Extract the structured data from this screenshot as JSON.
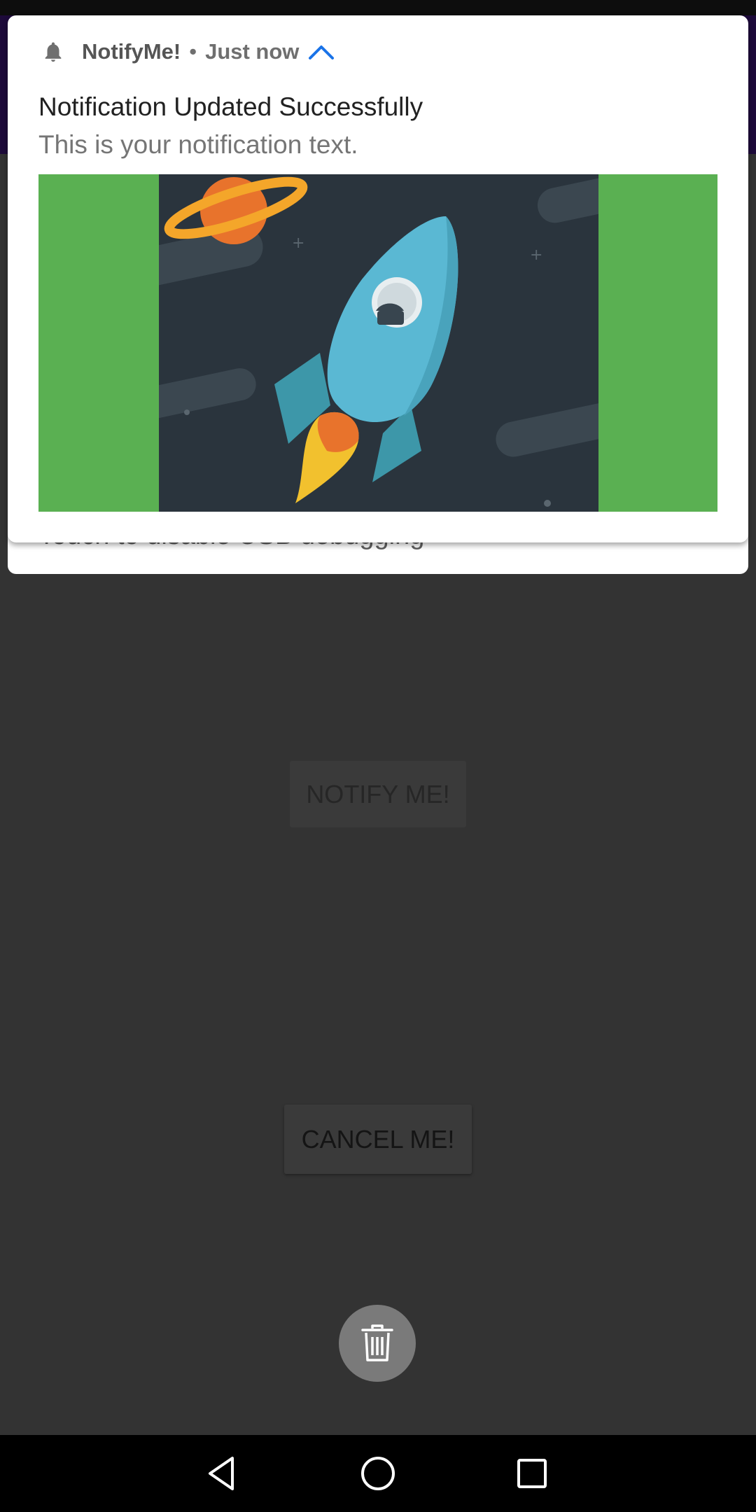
{
  "notification": {
    "app_name": "NotifyMe!",
    "separator": "•",
    "time": "Just now",
    "title": "Notification Updated Successfully",
    "text": "This is your notification text.",
    "accent_color": "#1a73e8",
    "picture_background": "#5ab052",
    "icon": "bell-icon",
    "expand_icon": "chevron-up-icon"
  },
  "notification_behind": {
    "text": "Touch to disable USB debugging"
  },
  "app": {
    "notify_button": "NOTIFY ME!",
    "cancel_button": "CANCEL ME!",
    "fab_icon": "trash-icon"
  },
  "nav": {
    "back_icon": "back-triangle-icon",
    "home_icon": "home-circle-icon",
    "recents_icon": "recents-square-icon"
  }
}
